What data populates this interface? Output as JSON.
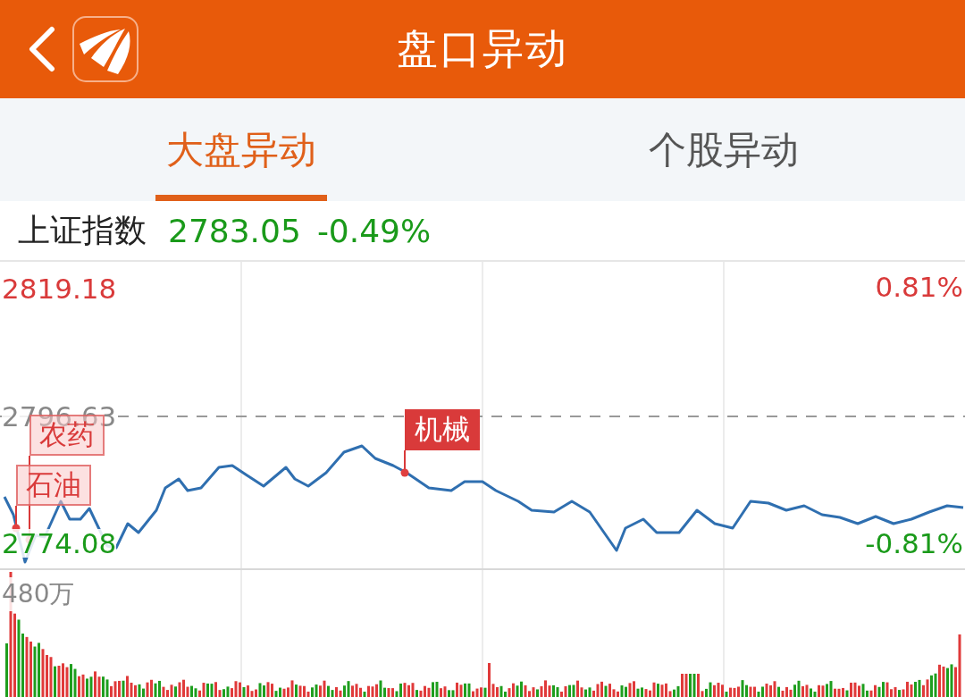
{
  "header": {
    "title": "盘口异动"
  },
  "tabs": [
    {
      "label": "大盘异动",
      "selected": true
    },
    {
      "label": "个股异动",
      "selected": false
    }
  ],
  "index": {
    "name": "上证指数",
    "price": "2783.05",
    "change": "-0.49%"
  },
  "price_chart": {
    "left_labels": [
      "2819.18",
      "2796.63",
      "2774.08"
    ],
    "right_labels": [
      "0.81%",
      "-0.81%"
    ],
    "flags": [
      {
        "text": "石油",
        "highlighted": false
      },
      {
        "text": "农药",
        "highlighted": false
      },
      {
        "text": "机械",
        "highlighted": true
      }
    ]
  },
  "volume": {
    "max_label": "480万"
  }
}
